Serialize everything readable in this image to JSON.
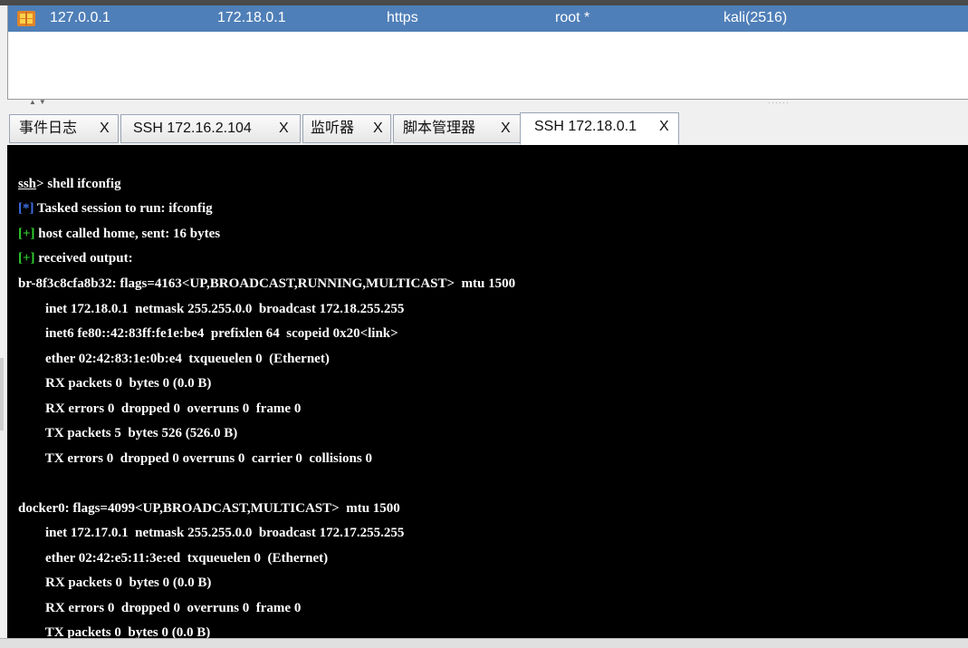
{
  "sessions": {
    "row": {
      "external": "127.0.0.1",
      "internal": "172.18.0.1",
      "listener": "https",
      "user": "root *",
      "computer": "kali(2516)"
    }
  },
  "tabs": [
    {
      "label": "事件日志",
      "close": "X"
    },
    {
      "label": "SSH 172.16.2.104",
      "close": "X"
    },
    {
      "label": "监听器",
      "close": "X"
    },
    {
      "label": "脚本管理器",
      "close": "X"
    },
    {
      "label": "SSH 172.18.0.1",
      "close": "X"
    }
  ],
  "console": {
    "prompt": "ssh",
    "command": "> shell ifconfig",
    "tasked_marker": "[*]",
    "tasked_text": " Tasked session to run: ifconfig",
    "called_marker": "[+]",
    "called_text": " host called home, sent: 16 bytes",
    "received_marker": "[+]",
    "received_text": " received output:",
    "output": [
      "br-8f3c8cfa8b32: flags=4163<UP,BROADCAST,RUNNING,MULTICAST>  mtu 1500",
      "        inet 172.18.0.1  netmask 255.255.0.0  broadcast 172.18.255.255",
      "        inet6 fe80::42:83ff:fe1e:be4  prefixlen 64  scopeid 0x20<link>",
      "        ether 02:42:83:1e:0b:e4  txqueuelen 0  (Ethernet)",
      "        RX packets 0  bytes 0 (0.0 B)",
      "        RX errors 0  dropped 0  overruns 0  frame 0",
      "        TX packets 5  bytes 526 (526.0 B)",
      "        TX errors 0  dropped 0 overruns 0  carrier 0  collisions 0",
      "",
      "docker0: flags=4099<UP,BROADCAST,MULTICAST>  mtu 1500",
      "        inet 172.17.0.1  netmask 255.255.0.0  broadcast 172.17.255.255",
      "        ether 02:42:e5:11:3e:ed  txqueuelen 0  (Ethernet)",
      "        RX packets 0  bytes 0 (0.0 B)",
      "        RX errors 0  dropped 0  overruns 0  frame 0",
      "        TX packets 0  bytes 0 (0.0 B)"
    ]
  },
  "colors": {
    "session_row_bg": "#4f7fb8",
    "console_bg": "#000000",
    "marker_info": "#3f6fe8",
    "marker_ok": "#2fd12f"
  },
  "icons": {
    "session_icon": "windows-beacon-icon",
    "splitter_arrows": "collapse-arrows-icon",
    "splitter_grip": "drag-grip-icon"
  }
}
